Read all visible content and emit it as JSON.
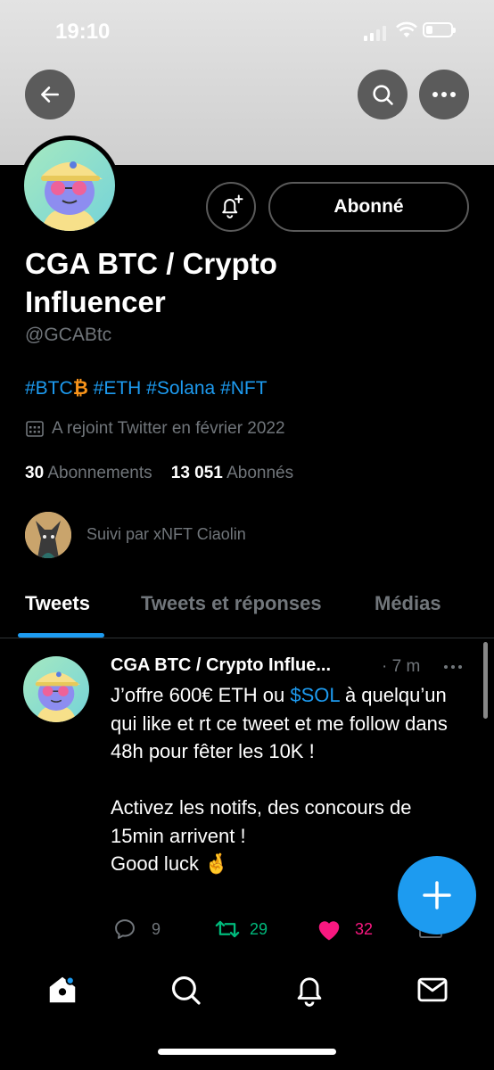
{
  "status_bar": {
    "time": "19:10"
  },
  "profile": {
    "follow_label": "Abonné",
    "name": "CGA BTC / Crypto Influencer",
    "handle": "@GCABtc",
    "bio_prefix": "#BTC",
    "bio_btc": "₿",
    "bio_rest": " #ETH #Solana #NFT",
    "joined": "A rejoint Twitter en février 2022",
    "following_count": "30",
    "following_label": "Abonnements",
    "followers_count": "13 051",
    "followers_label": "Abonnés",
    "followed_by": "Suivi par xNFT Ciaolin"
  },
  "tabs": [
    {
      "label": "Tweets"
    },
    {
      "label": "Tweets et réponses"
    },
    {
      "label": "Médias"
    }
  ],
  "tweet": {
    "author": "CGA BTC / Crypto Influe...",
    "time": "· 7 m",
    "text_1": "J’offre 600€ ETH ou ",
    "text_link": "$SOL",
    "text_2": " à quelqu’un qui like et rt ce tweet et me follow dans 48h pour fêter les 10K !\n\nActivez les notifs, des concours de 15min arrivent !\nGood luck 🤞",
    "replies": "9",
    "retweets": "29",
    "likes": "32"
  },
  "colors": {
    "accent": "#1d9bf0",
    "retweet": "#00ba7c",
    "like": "#f91880",
    "btc": "#f7931a"
  },
  "icons": [
    "back-arrow-icon",
    "search-icon",
    "more-icon",
    "bell-plus-icon",
    "calendar-icon",
    "reply-icon",
    "retweet-icon",
    "heart-icon",
    "share-icon",
    "compose-plus-icon",
    "home-icon",
    "explore-icon",
    "notifications-icon",
    "messages-icon"
  ]
}
